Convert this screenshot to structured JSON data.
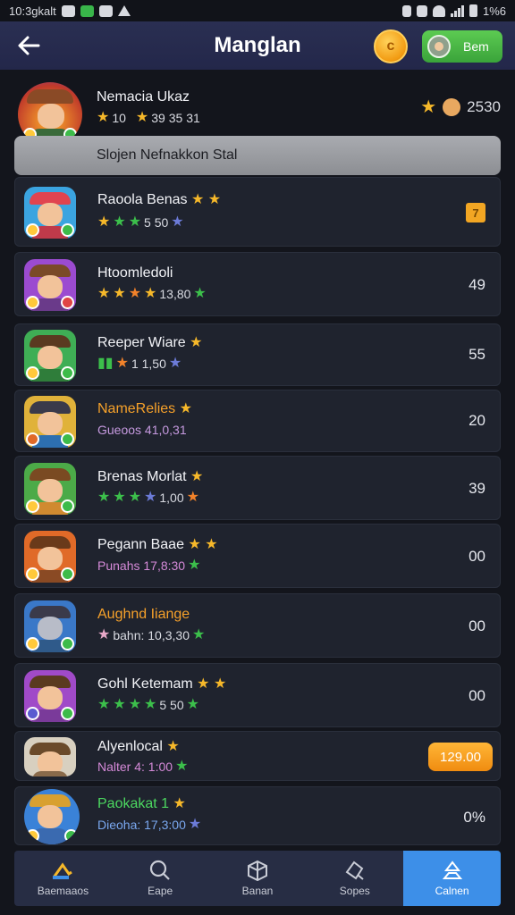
{
  "status_bar": {
    "time": "10:3gkalt",
    "battery": "1%6"
  },
  "app_bar": {
    "title": "Manglan",
    "profile_label": "Bem",
    "coin_symbol": "c"
  },
  "featured": {
    "name": "Nemacia Ukaz",
    "rank": "10",
    "score_line": "39 35 31",
    "value": "2530"
  },
  "banner": {
    "text": "Slojen Nefnakkon Stal"
  },
  "rows": [
    {
      "name": "Raoola Benas",
      "name_color": "#f2f3f7",
      "sub_text": "5 50",
      "sub_color": "#d9dbe2",
      "value": "",
      "right_kind": "badge",
      "badge_label": "7",
      "colors": {
        "bg": "#3ba4e0",
        "hat": "#e04450",
        "body": "#c03a4a"
      }
    },
    {
      "name": "Htoomledoli",
      "name_color": "#f2f3f7",
      "sub_text": "13,80",
      "sub_color": "#d9dbe2",
      "value": "49",
      "right_kind": "value",
      "colors": {
        "bg": "#9b4bd0",
        "hat": "#7a4a28",
        "body": "#6a3a8a"
      }
    },
    {
      "name": "Reeper Wiare",
      "name_color": "#f6a12a",
      "sub_text": "1 1,50",
      "sub_color": "#d9dbe2",
      "value": "55",
      "right_kind": "value",
      "colors": {
        "bg": "#3fae55",
        "hat": "#5a3a20",
        "body": "#2f7d3a"
      }
    },
    {
      "name": "NameRelies",
      "name_color": "#f6a12a",
      "sub_text": "Gueoos 41,0,31",
      "sub_color": "#c69ae0",
      "value": "20",
      "right_kind": "value",
      "colors": {
        "bg": "#e0b23a",
        "hat": "#3a3a4a",
        "body": "#2d6fb0"
      }
    },
    {
      "name": "Brenas Morlat",
      "name_color": "#f2f3f7",
      "sub_text": "1,00",
      "sub_color": "#d9dbe2",
      "value": "39",
      "right_kind": "value",
      "colors": {
        "bg": "#4caa48",
        "hat": "#7a4a22",
        "body": "#d08a30"
      }
    },
    {
      "name": "Pegann Baae",
      "name_color": "#f2f3f7",
      "sub_text": "Punahs 17,8:30",
      "sub_color": "#d58ad8",
      "value": "00",
      "right_kind": "value",
      "colors": {
        "bg": "#e06a28",
        "hat": "#6a3a1a",
        "body": "#8a4a24"
      }
    },
    {
      "name": "Aughnd Iiange",
      "name_color": "#f6a12a",
      "sub_text": "bahn: 10,3,30",
      "sub_color": "#d9dbe2",
      "value": "00",
      "right_kind": "value",
      "colors": {
        "bg": "#3a78c8",
        "hat": "#3a3a4a",
        "body": "#2f5a8a"
      }
    },
    {
      "name": "Gohl Ketemam",
      "name_color": "#f2f3f7",
      "sub_text": "5 50",
      "sub_color": "#d9dbe2",
      "value": "00",
      "right_kind": "value",
      "colors": {
        "bg": "#a04ac8",
        "hat": "#5a3a20",
        "body": "#7a3a9a"
      }
    },
    {
      "name": "Alyenlocal",
      "name_color": "#f2f3f7",
      "sub_text": "Nalter 4: 1:00",
      "sub_color": "#d58ad8",
      "value": "",
      "right_kind": "price",
      "price": "129.00",
      "colors": {
        "bg": "#d8d0c0",
        "hat": "#6a4a2a",
        "body": "#8a6a4a"
      }
    },
    {
      "name": "Paokakat 1",
      "name_color": "#4cd860",
      "sub_text": "Dieoha: 17,3:00",
      "sub_color": "#7aa8f0",
      "value": "0%",
      "right_kind": "value",
      "colors": {
        "bg": "#3a82d8",
        "hat": "#d8a030",
        "body": "#3a6ab0"
      }
    }
  ],
  "tabs": [
    {
      "label": "Baemaaos",
      "icon": "home-icon"
    },
    {
      "label": "Eape",
      "icon": "search-icon"
    },
    {
      "label": "Banan",
      "icon": "cube-icon"
    },
    {
      "label": "Sopes",
      "icon": "explore-icon"
    },
    {
      "label": "Calnen",
      "icon": "profile-icon"
    }
  ]
}
